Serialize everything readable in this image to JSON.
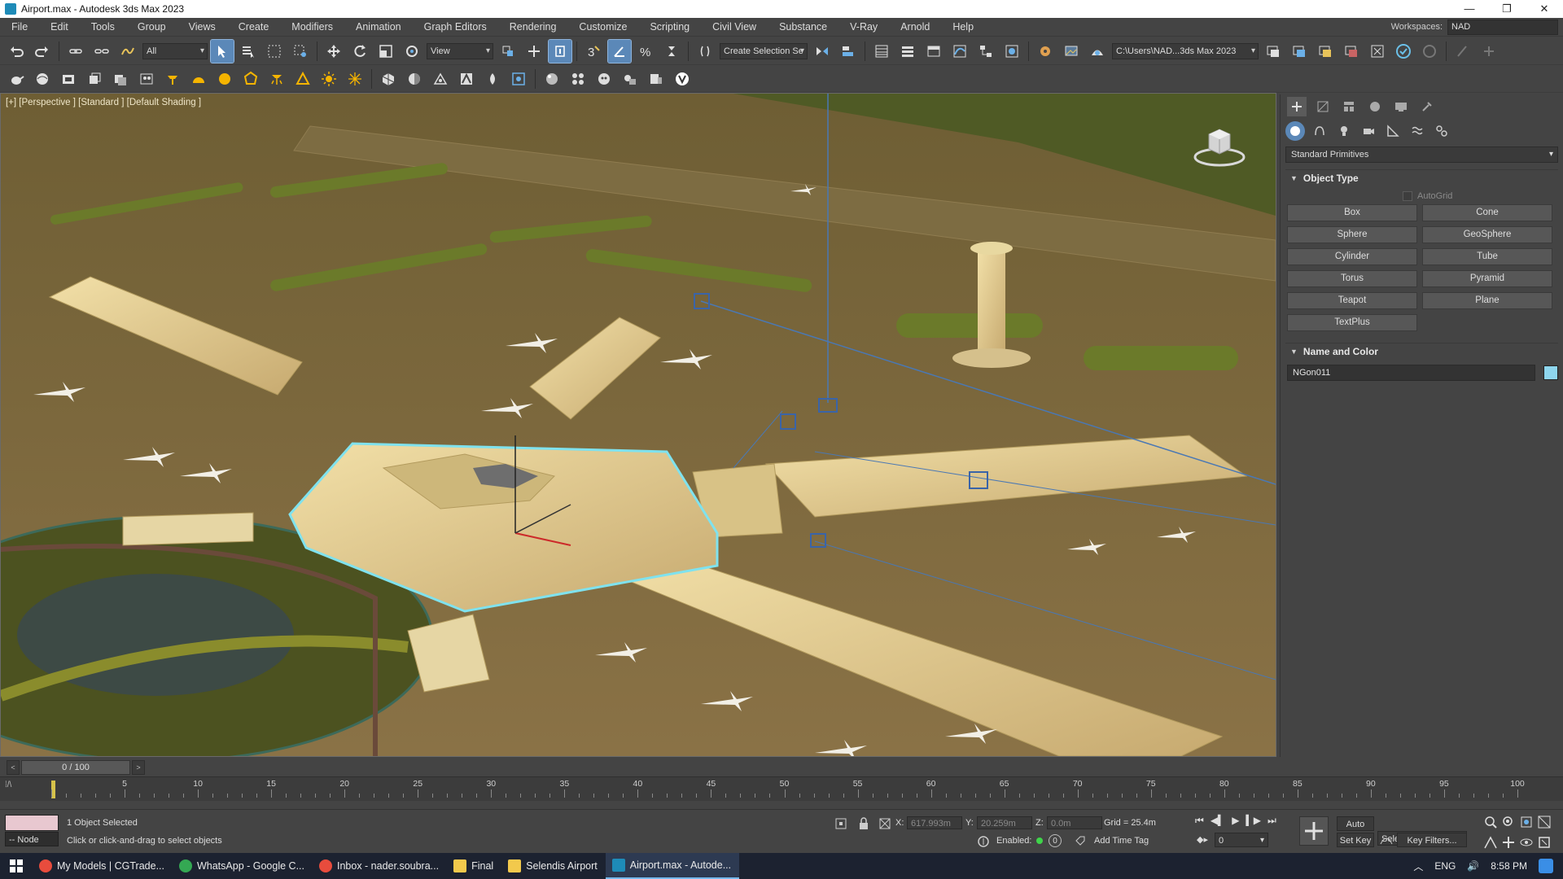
{
  "window": {
    "title": "Airport.max - Autodesk 3ds Max 2023",
    "minimize": "—",
    "restore": "❐",
    "close": "✕"
  },
  "menu": {
    "items": [
      "File",
      "Edit",
      "Tools",
      "Group",
      "Views",
      "Create",
      "Modifiers",
      "Animation",
      "Graph Editors",
      "Rendering",
      "Customize",
      "Scripting",
      "Civil View",
      "Substance",
      "V-Ray",
      "Arnold",
      "Help"
    ],
    "workspaces_label": "Workspaces:",
    "workspaces_value": "NAD"
  },
  "toolbar1": {
    "selection_filter": "All",
    "ref_coord": "View",
    "selection_set": "Create Selection Se",
    "project_path": "C:\\Users\\NAD...3ds Max 2023"
  },
  "viewport": {
    "label": "[+] [Perspective ] [Standard ] [Default Shading ]",
    "viewcube_icon": "viewcube-icon"
  },
  "command_panel": {
    "category": "Standard Primitives",
    "object_type_title": "Object Type",
    "autogrid_label": "AutoGrid",
    "buttons": [
      "Box",
      "Cone",
      "Sphere",
      "GeoSphere",
      "Cylinder",
      "Tube",
      "Torus",
      "Pyramid",
      "Teapot",
      "Plane",
      "TextPlus"
    ],
    "name_color_title": "Name and Color",
    "object_name": "NGon011",
    "object_color": "#8ed6ee"
  },
  "timeline": {
    "frame_display": "0 / 100",
    "ticks": [
      "5",
      "10",
      "15",
      "20",
      "25",
      "30",
      "35",
      "40",
      "45",
      "50",
      "55",
      "60",
      "65",
      "70",
      "75",
      "80",
      "85",
      "90",
      "95",
      "100"
    ]
  },
  "status": {
    "node_label": "-- Node",
    "selection_info": "1 Object Selected",
    "prompt": "Click or click-and-drag to select objects",
    "x_label": "X:",
    "x_value": "617.993m",
    "y_label": "Y:",
    "y_value": "20.259m",
    "z_label": "Z:",
    "z_value": "0.0m",
    "grid": "Grid = 25.4m",
    "enabled_label": "Enabled:",
    "enabled_value": "0",
    "add_time_tag": "Add Time Tag",
    "auto_key": "Auto Key",
    "set_key": "Set Key",
    "key_mode": "Selected",
    "key_filters": "Key Filters...",
    "current_frame": "0"
  },
  "taskbar": {
    "apps": [
      {
        "label": "My Models | CGTrade...",
        "color": "#e84c3d"
      },
      {
        "label": "WhatsApp - Google C...",
        "color": "#34a853"
      },
      {
        "label": "Inbox - nader.soubra...",
        "color": "#e84c3d"
      },
      {
        "label": "Final",
        "color": "#f2c94c"
      },
      {
        "label": "Selendis Airport",
        "color": "#f2c94c"
      },
      {
        "label": "Airport.max - Autode...",
        "color": "#1e8bb8"
      }
    ],
    "language": "ENG",
    "time": "8:58 PM"
  }
}
